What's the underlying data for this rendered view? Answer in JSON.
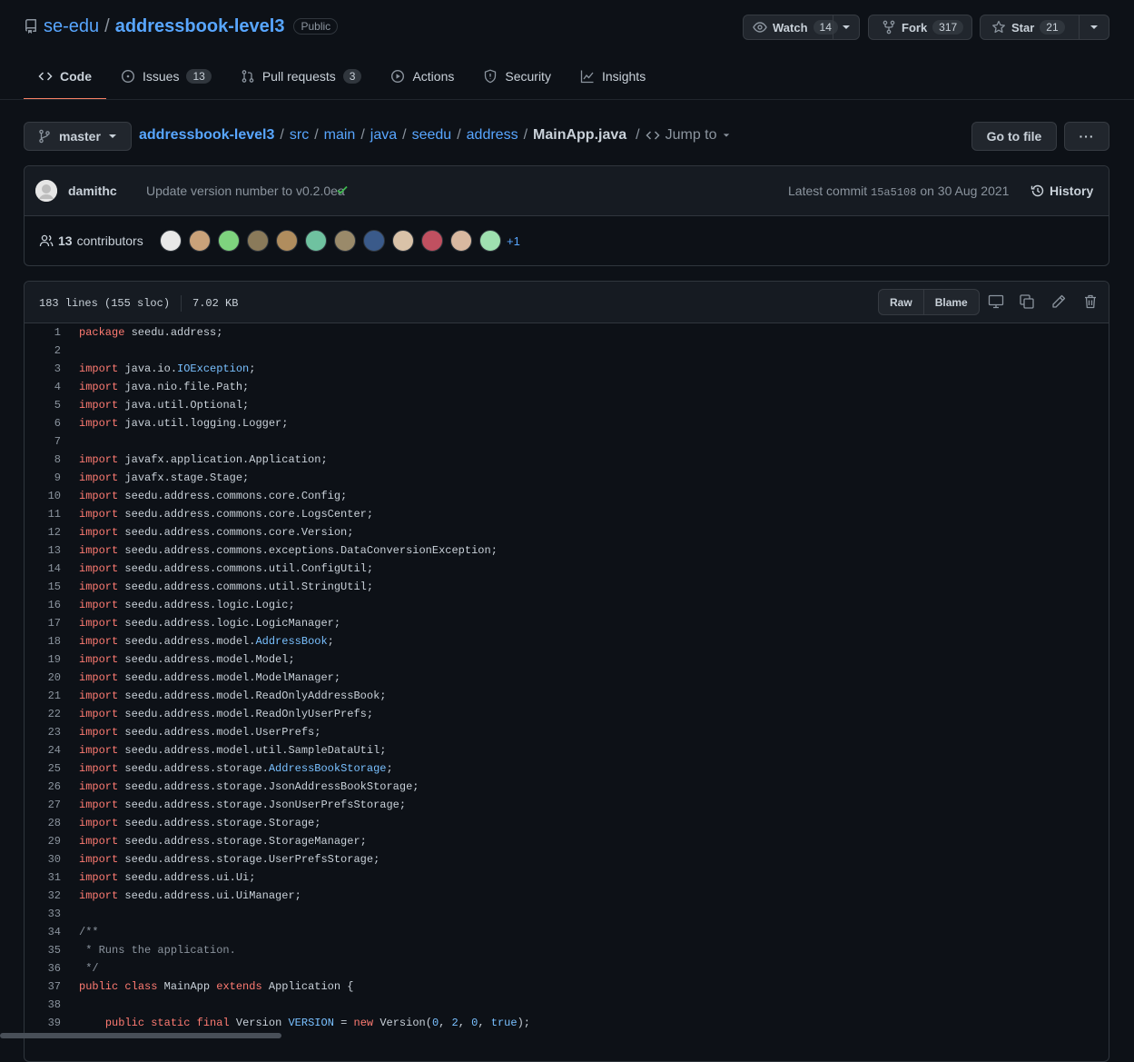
{
  "repo": {
    "owner": "se-edu",
    "separator": "/",
    "name": "addressbook-level3",
    "visibility": "Public"
  },
  "actions": {
    "watch": {
      "label": "Watch",
      "count": "14"
    },
    "fork": {
      "label": "Fork",
      "count": "317"
    },
    "star": {
      "label": "Star",
      "count": "21"
    }
  },
  "tabs": [
    {
      "label": "Code",
      "count": null,
      "icon": "code-icon"
    },
    {
      "label": "Issues",
      "count": "13",
      "icon": "issue-icon"
    },
    {
      "label": "Pull requests",
      "count": "3",
      "icon": "pull-request-icon"
    },
    {
      "label": "Actions",
      "count": null,
      "icon": "play-icon"
    },
    {
      "label": "Security",
      "count": null,
      "icon": "shield-icon"
    },
    {
      "label": "Insights",
      "count": null,
      "icon": "graph-icon"
    }
  ],
  "branch": "master",
  "breadcrumb": {
    "segments": [
      "addressbook-level3",
      "src",
      "main",
      "java",
      "seedu",
      "address"
    ],
    "file": "MainApp.java",
    "jump_to": "Jump to"
  },
  "goto_file": "Go to file",
  "more_label": "···",
  "commit": {
    "author": "damithc",
    "message": "Update version number to v0.2.0ea",
    "latest_prefix": "Latest commit",
    "sha": "15a5108",
    "date": "on 30 Aug 2021",
    "history": "History"
  },
  "contributors": {
    "count": "13",
    "label": "contributors",
    "more": "+1",
    "avatar_colors": [
      "#e8e8e8",
      "#c9a27a",
      "#7ed37e",
      "#8a7a5a",
      "#b08d5e",
      "#6fc2a0",
      "#9a8a6a",
      "#3a5a8a",
      "#d9c2a8",
      "#c05060",
      "#d8b8a0",
      "#9fe0b0"
    ]
  },
  "file": {
    "lines": "183 lines (155 sloc)",
    "size": "7.02 KB",
    "raw": "Raw",
    "blame": "Blame"
  },
  "code_lines": [
    [
      [
        "kw",
        "package"
      ],
      [
        "",
        "seedu.address;"
      ]
    ],
    [],
    [
      [
        "kw",
        "import"
      ],
      [
        "",
        "java.io."
      ],
      [
        "ty",
        "IOException"
      ],
      [
        "",
        ";"
      ]
    ],
    [
      [
        "kw",
        "import"
      ],
      [
        "",
        "java.nio.file.Path;"
      ]
    ],
    [
      [
        "kw",
        "import"
      ],
      [
        "",
        "java.util.Optional;"
      ]
    ],
    [
      [
        "kw",
        "import"
      ],
      [
        "",
        "java.util.logging.Logger;"
      ]
    ],
    [],
    [
      [
        "kw",
        "import"
      ],
      [
        "",
        "javafx.application.Application;"
      ]
    ],
    [
      [
        "kw",
        "import"
      ],
      [
        "",
        "javafx.stage.Stage;"
      ]
    ],
    [
      [
        "kw",
        "import"
      ],
      [
        "",
        "seedu.address.commons.core.Config;"
      ]
    ],
    [
      [
        "kw",
        "import"
      ],
      [
        "",
        "seedu.address.commons.core.LogsCenter;"
      ]
    ],
    [
      [
        "kw",
        "import"
      ],
      [
        "",
        "seedu.address.commons.core.Version;"
      ]
    ],
    [
      [
        "kw",
        "import"
      ],
      [
        "",
        "seedu.address.commons.exceptions.DataConversionException;"
      ]
    ],
    [
      [
        "kw",
        "import"
      ],
      [
        "",
        "seedu.address.commons.util.ConfigUtil;"
      ]
    ],
    [
      [
        "kw",
        "import"
      ],
      [
        "",
        "seedu.address.commons.util.StringUtil;"
      ]
    ],
    [
      [
        "kw",
        "import"
      ],
      [
        "",
        "seedu.address.logic.Logic;"
      ]
    ],
    [
      [
        "kw",
        "import"
      ],
      [
        "",
        "seedu.address.logic.LogicManager;"
      ]
    ],
    [
      [
        "kw",
        "import"
      ],
      [
        "",
        "seedu.address.model."
      ],
      [
        "ty",
        "AddressBook"
      ],
      [
        "",
        ";"
      ]
    ],
    [
      [
        "kw",
        "import"
      ],
      [
        "",
        "seedu.address.model.Model;"
      ]
    ],
    [
      [
        "kw",
        "import"
      ],
      [
        "",
        "seedu.address.model.ModelManager;"
      ]
    ],
    [
      [
        "kw",
        "import"
      ],
      [
        "",
        "seedu.address.model.ReadOnlyAddressBook;"
      ]
    ],
    [
      [
        "kw",
        "import"
      ],
      [
        "",
        "seedu.address.model.ReadOnlyUserPrefs;"
      ]
    ],
    [
      [
        "kw",
        "import"
      ],
      [
        "",
        "seedu.address.model.UserPrefs;"
      ]
    ],
    [
      [
        "kw",
        "import"
      ],
      [
        "",
        "seedu.address.model.util.SampleDataUtil;"
      ]
    ],
    [
      [
        "kw",
        "import"
      ],
      [
        "",
        "seedu.address.storage."
      ],
      [
        "ty",
        "AddressBookStorage"
      ],
      [
        "",
        ";"
      ]
    ],
    [
      [
        "kw",
        "import"
      ],
      [
        "",
        "seedu.address.storage.JsonAddressBookStorage;"
      ]
    ],
    [
      [
        "kw",
        "import"
      ],
      [
        "",
        "seedu.address.storage.JsonUserPrefsStorage;"
      ]
    ],
    [
      [
        "kw",
        "import"
      ],
      [
        "",
        "seedu.address.storage.Storage;"
      ]
    ],
    [
      [
        "kw",
        "import"
      ],
      [
        "",
        "seedu.address.storage.StorageManager;"
      ]
    ],
    [
      [
        "kw",
        "import"
      ],
      [
        "",
        "seedu.address.storage.UserPrefsStorage;"
      ]
    ],
    [
      [
        "kw",
        "import"
      ],
      [
        "",
        "seedu.address.ui.Ui;"
      ]
    ],
    [
      [
        "kw",
        "import"
      ],
      [
        "",
        "seedu.address.ui.UiManager;"
      ]
    ],
    [],
    [
      [
        "cm",
        "/**"
      ]
    ],
    [
      [
        "cm",
        " * Runs the application."
      ]
    ],
    [
      [
        "cm",
        " */"
      ]
    ],
    [
      [
        "kw",
        "public"
      ],
      [
        "",
        " "
      ],
      [
        "kw",
        "class"
      ],
      [
        "",
        " MainApp "
      ],
      [
        "kw",
        "extends"
      ],
      [
        "",
        " Application {"
      ]
    ],
    [],
    [
      [
        "",
        "    "
      ],
      [
        "kw",
        "public"
      ],
      [
        "",
        " "
      ],
      [
        "kw",
        "static"
      ],
      [
        "",
        " "
      ],
      [
        "kw",
        "final"
      ],
      [
        "",
        " Version "
      ],
      [
        "ty",
        "VERSION"
      ],
      [
        "",
        " = "
      ],
      [
        "kw",
        "new"
      ],
      [
        "",
        " Version("
      ],
      [
        "ty",
        "0"
      ],
      [
        "",
        ", "
      ],
      [
        "ty",
        "2"
      ],
      [
        "",
        ", "
      ],
      [
        "ty",
        "0"
      ],
      [
        "",
        ", "
      ],
      [
        "ty",
        "true"
      ],
      [
        "",
        ");"
      ]
    ]
  ]
}
